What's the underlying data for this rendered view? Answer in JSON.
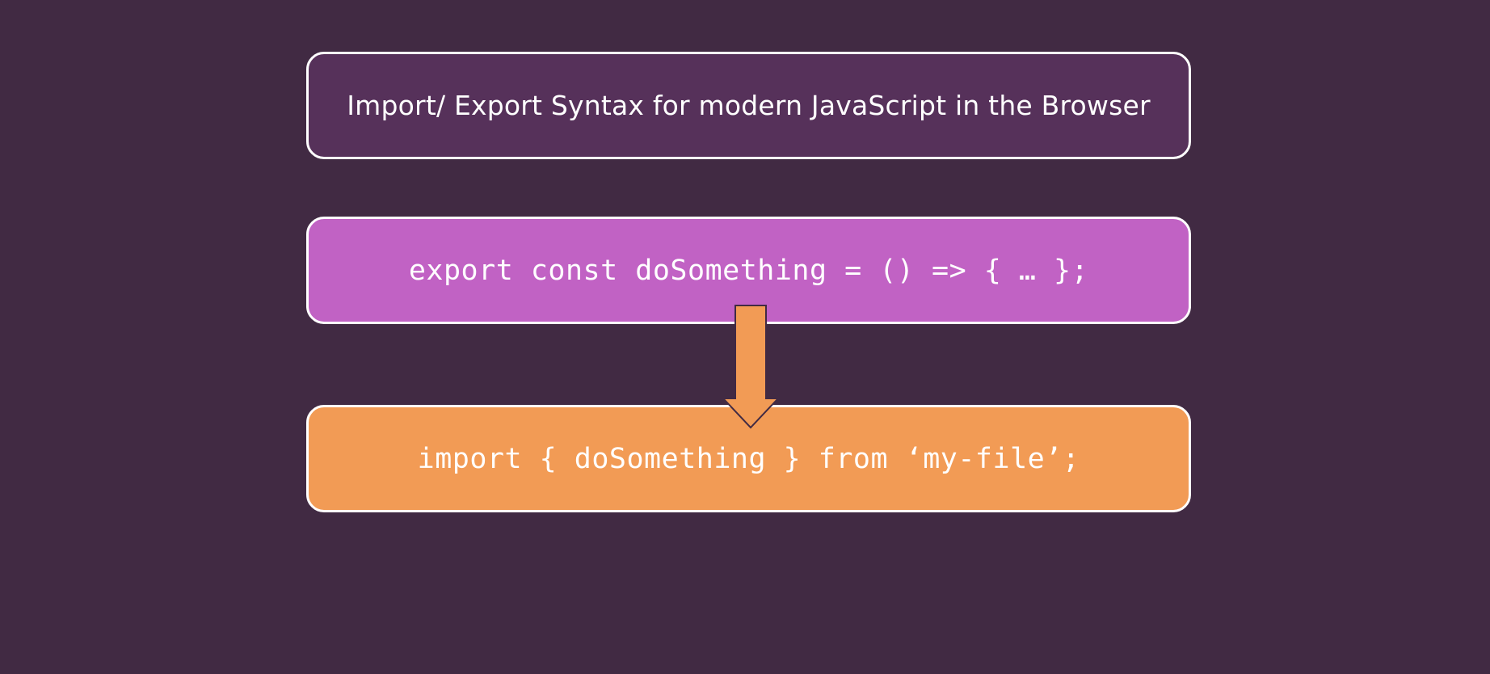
{
  "slide": {
    "title": "Import/ Export Syntax for modern JavaScript in the Browser",
    "export_code": "export const doSomething = () => { … };",
    "import_code": "import { doSomething } from ‘my-file’;"
  },
  "colors": {
    "background": "#412a43",
    "title_box": "#56315a",
    "export_box": "#c162c4",
    "import_box": "#f29b55",
    "arrow": "#f29b55",
    "border": "#ffffff"
  },
  "icons": {
    "arrow": "arrow-down-icon"
  }
}
